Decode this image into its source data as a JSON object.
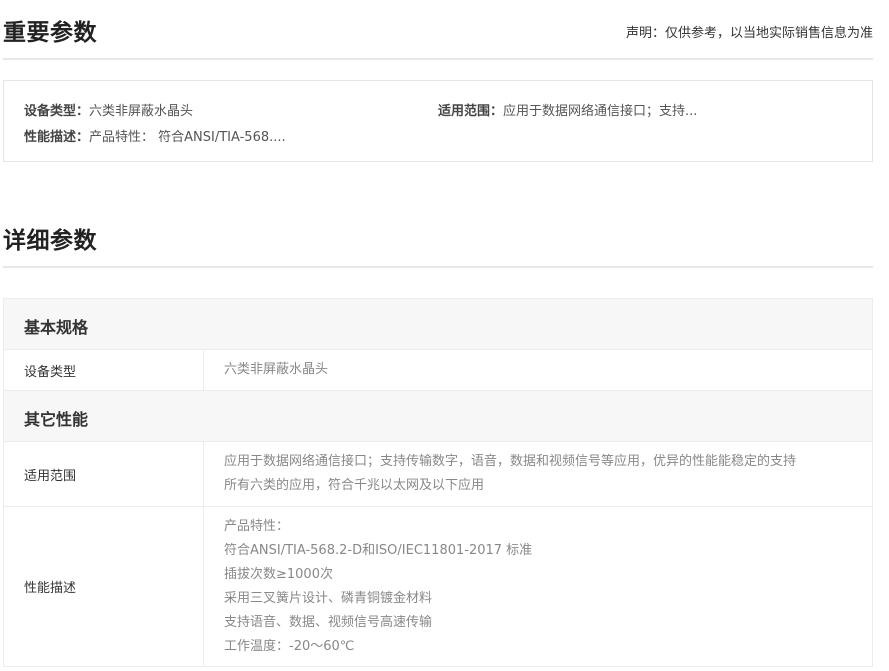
{
  "important": {
    "title": "重要参数",
    "disclaimer": "声明：仅供参考，以当地实际销售信息为准",
    "summary": [
      {
        "key": "设备类型：",
        "value": "六类非屏蔽水晶头"
      },
      {
        "key": "适用范围：",
        "value": "应用于数据网络通信接口；支持..."
      },
      {
        "key": "性能描述：",
        "value": "产品特性：  符合ANSI/TIA-568...."
      }
    ]
  },
  "detail": {
    "title": "详细参数",
    "groups": [
      {
        "name": "基本规格",
        "rows": [
          {
            "label": "设备类型",
            "lines": [
              "六类非屏蔽水晶头"
            ]
          }
        ]
      },
      {
        "name": "其它性能",
        "rows": [
          {
            "label": "适用范围",
            "lines": [
              "应用于数据网络通信接口；支持传输数字，语音，数据和视频信号等应用，优异的性能能稳定的支持",
              "所有六类的应用，符合千兆以太网及以下应用"
            ]
          },
          {
            "label": "性能描述",
            "lines": [
              "产品特性：",
              "符合ANSI/TIA-568.2-D和ISO/IEC11801-2017 标准",
              "插拔次数≥1000次",
              "采用三叉簧片设计、磷青铜镀金材料",
              "支持语音、数据、视频信号高速传输",
              "工作温度：-20～60℃"
            ]
          }
        ]
      }
    ]
  }
}
